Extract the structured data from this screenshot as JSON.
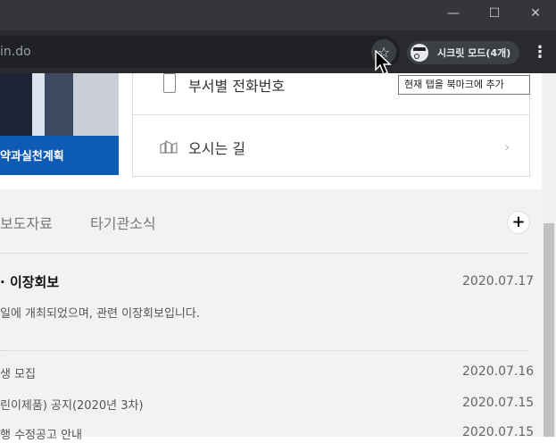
{
  "browser": {
    "url_fragment": "in.do",
    "incognito_label": "시크릿 모드(4개)",
    "bookmark_tooltip": "현재 탭을 북마크에 추가",
    "window_controls": [
      "—",
      "☐",
      "✕"
    ],
    "menu_glyph": "⋮",
    "star_glyph": "☆"
  },
  "page": {
    "banner_text": "약과실천계획",
    "quick_links": [
      {
        "label": "부서별 전화번호",
        "icon": "phone-icon"
      },
      {
        "label": "오시는 길",
        "icon": "map-icon"
      }
    ],
    "chevron_glyph": "›",
    "tabs": [
      "보도자료",
      "타기관소식"
    ],
    "more_glyph": "+",
    "featured": {
      "title": "이장회보",
      "title_prefix": "·",
      "date": "2020.07.17",
      "desc": "일에 개최되었으며, 관련 이장회보입니다."
    },
    "news": [
      {
        "title": "생 모집",
        "date": "2020.07.16"
      },
      {
        "title": "린이제품) 공지(2020년 3차)",
        "date": "2020.07.15"
      },
      {
        "title": "행 수정공고 안내",
        "date": "2020.07.15"
      }
    ]
  },
  "colors": {
    "title_bar": "#35363a",
    "toolbar": "#292a2d",
    "omnibox": "#202124",
    "banner_blue": "#0d5bb5",
    "page_bg": "#f2f2f2"
  }
}
